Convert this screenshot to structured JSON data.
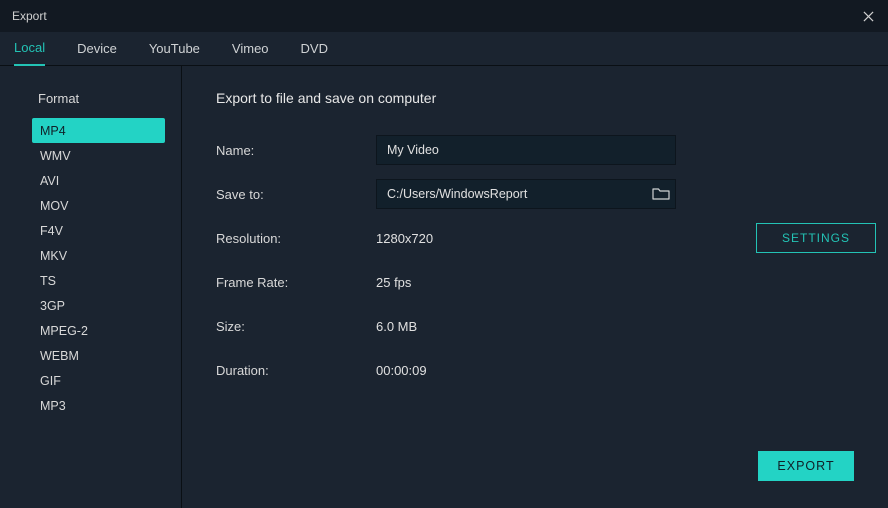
{
  "window": {
    "title": "Export"
  },
  "tabs": [
    {
      "label": "Local",
      "active": true
    },
    {
      "label": "Device",
      "active": false
    },
    {
      "label": "YouTube",
      "active": false
    },
    {
      "label": "Vimeo",
      "active": false
    },
    {
      "label": "DVD",
      "active": false
    }
  ],
  "sidebar": {
    "heading": "Format",
    "formats": [
      {
        "label": "MP4",
        "selected": true
      },
      {
        "label": "WMV",
        "selected": false
      },
      {
        "label": "AVI",
        "selected": false
      },
      {
        "label": "MOV",
        "selected": false
      },
      {
        "label": "F4V",
        "selected": false
      },
      {
        "label": "MKV",
        "selected": false
      },
      {
        "label": "TS",
        "selected": false
      },
      {
        "label": "3GP",
        "selected": false
      },
      {
        "label": "MPEG-2",
        "selected": false
      },
      {
        "label": "WEBM",
        "selected": false
      },
      {
        "label": "GIF",
        "selected": false
      },
      {
        "label": "MP3",
        "selected": false
      }
    ]
  },
  "main": {
    "heading": "Export to file and save on computer",
    "fields": {
      "name_label": "Name:",
      "name_value": "My Video",
      "saveto_label": "Save to:",
      "saveto_value": "C:/Users/WindowsReport",
      "resolution_label": "Resolution:",
      "resolution_value": "1280x720",
      "framerate_label": "Frame Rate:",
      "framerate_value": "25 fps",
      "size_label": "Size:",
      "size_value": "6.0 MB",
      "duration_label": "Duration:",
      "duration_value": "00:00:09"
    },
    "settings_label": "SETTINGS",
    "export_label": "EXPORT"
  }
}
